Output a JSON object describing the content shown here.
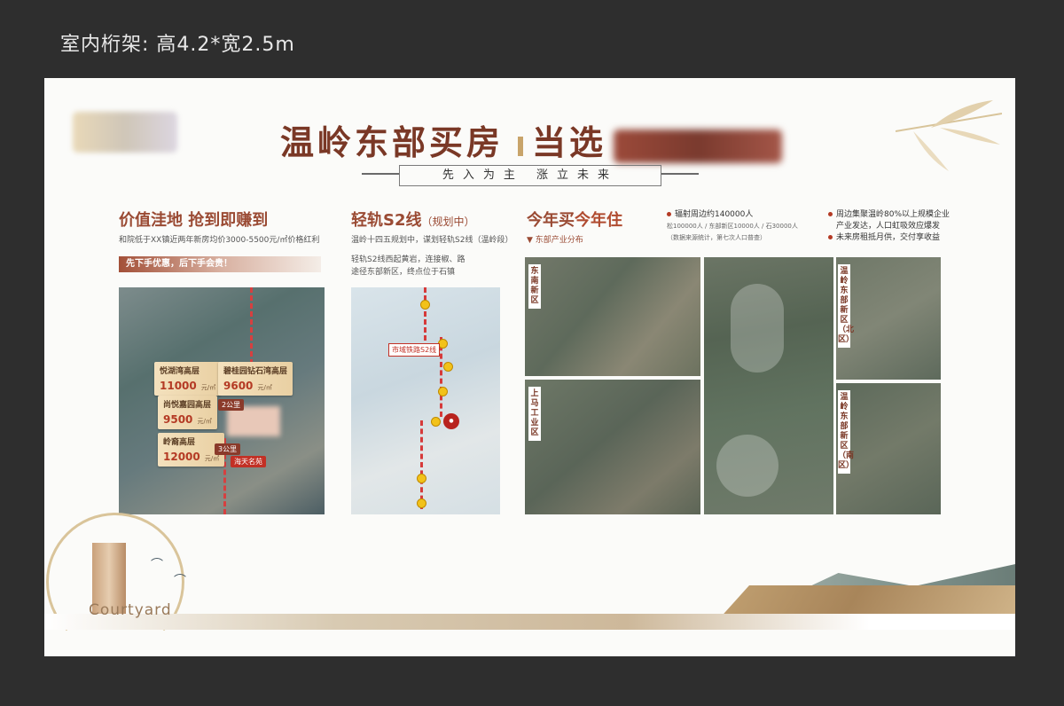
{
  "page_header": "室内桁架: 高4.2*宽2.5m",
  "headline": {
    "main": "温岭东部买房",
    "mid": "当选"
  },
  "tagline": "先入为主 涨立未来",
  "section1": {
    "title": "价值洼地 抢到即赚到",
    "desc": "和院低于XX镇近两年新房均价3000-5500元/㎡价格红利",
    "banner": "先下手优惠，后下手会贵！",
    "cards": [
      {
        "name": "悦湖湾高层",
        "price": "11000",
        "unit": "元/㎡"
      },
      {
        "name": "碧桂园钻石湾高层",
        "price": "9600",
        "unit": "元/㎡"
      },
      {
        "name": "尚悦嘉园高层",
        "price": "9500",
        "unit": "元/㎡"
      },
      {
        "name": "岭裔高层",
        "price": "12000",
        "unit": "元/㎡"
      }
    ],
    "pins": [
      "海天名苑",
      "3公里",
      "2公里"
    ]
  },
  "section2": {
    "title": "轻轨S2线",
    "title_note": "（规划中）",
    "desc1": "温岭十四五规划中，谋划轻轨S2线（温岭段）",
    "desc2": "轻轨S2线西起黄岩，连接椒、路\n途径东部新区，终点位于石镇",
    "map_label": "市域铁路S2线"
  },
  "section3": {
    "title_a": "今年买",
    "title_b": "今年住",
    "sub": "东部产业分布",
    "stats_title": "辐射周边约140000人",
    "stats_line": "松100000人 / 东部新区10000人 / 石30000人",
    "stats_note": "（数据来源统计，第七次人口普查）",
    "bullets": [
      "周边集聚温岭80%以上规模企业",
      "产业发达，人口虹吸效应爆发",
      "未来房租抵月供，交付享收益"
    ],
    "area_labels": [
      "东南新区",
      "上马工业区",
      "温岭东部新区（北区）",
      "温岭东部新区（南区）"
    ]
  },
  "brand_word": "Courtyard"
}
